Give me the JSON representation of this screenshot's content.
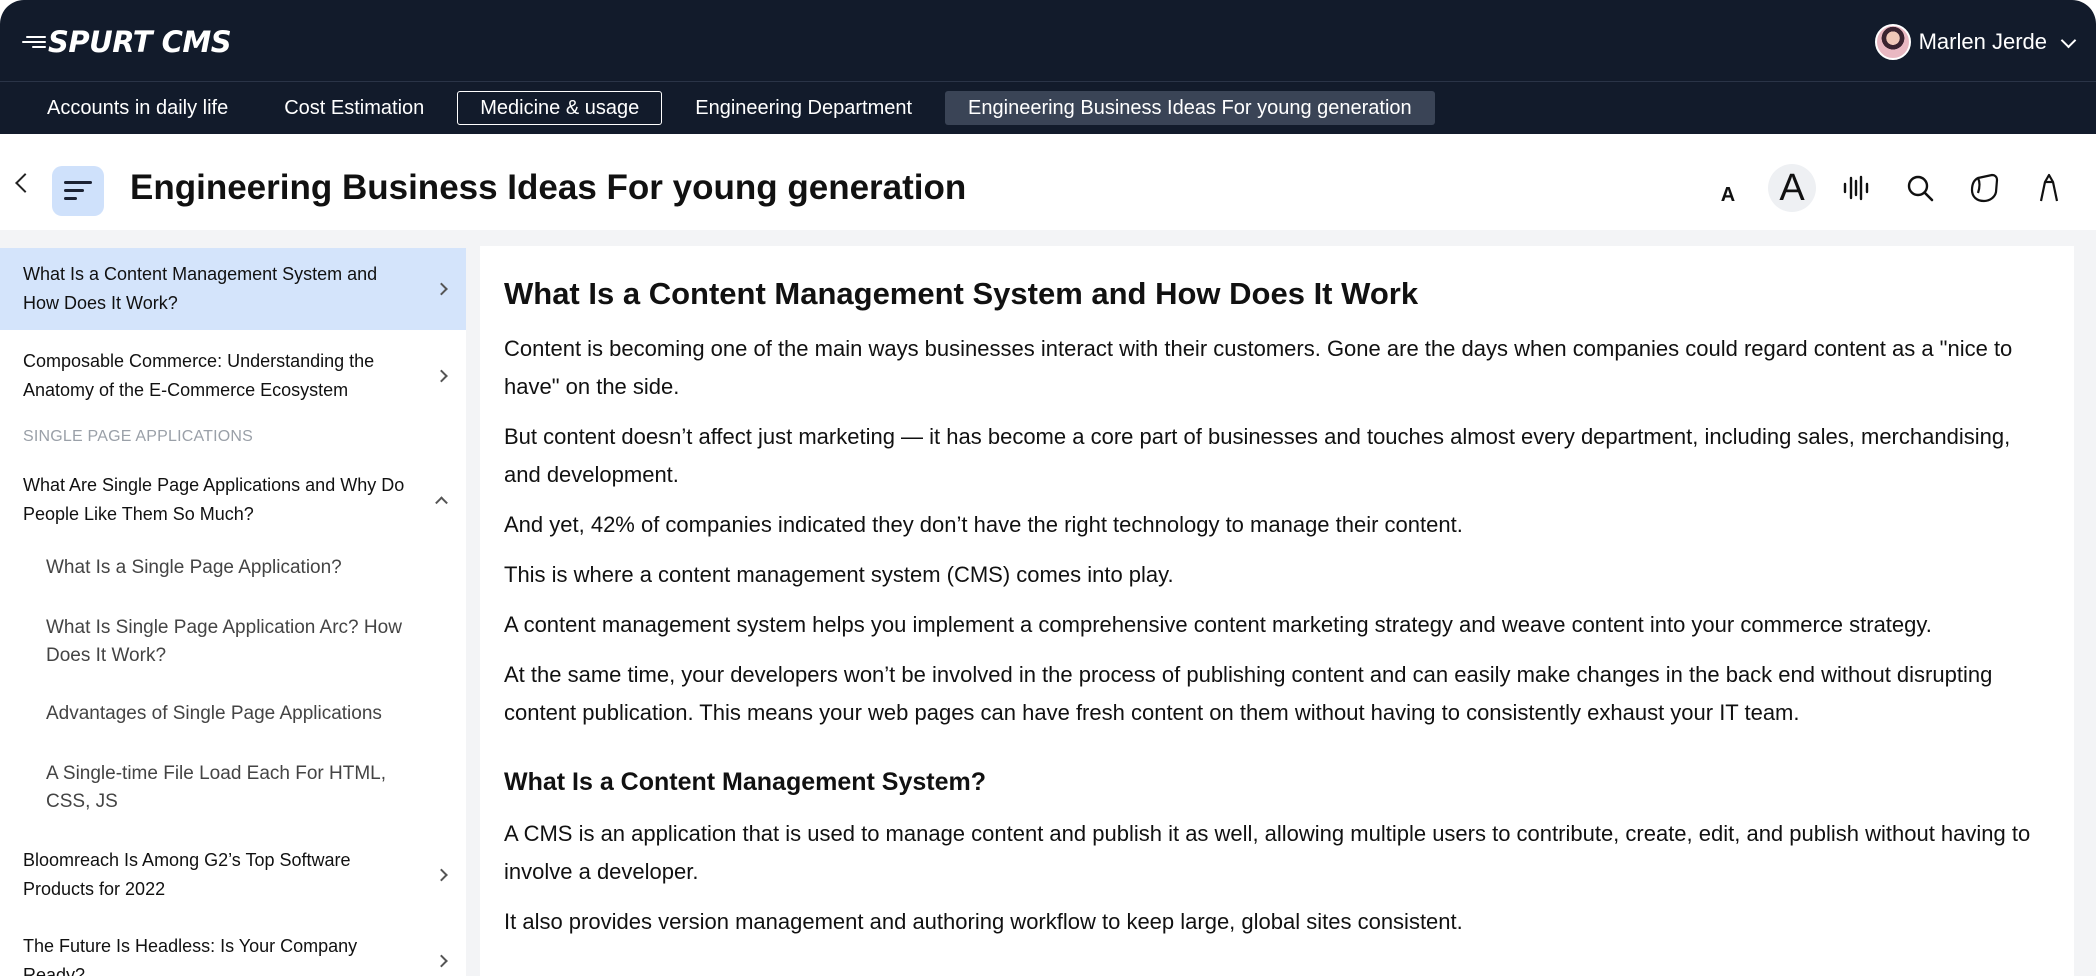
{
  "app": {
    "logo_text": "SPURT CMS"
  },
  "user": {
    "name": "Marlen Jerde"
  },
  "tabs": [
    {
      "label": "Accounts in daily life",
      "state": "normal"
    },
    {
      "label": "Cost Estimation",
      "state": "normal"
    },
    {
      "label": "Medicine & usage",
      "state": "outlined"
    },
    {
      "label": "Engineering Department",
      "state": "normal"
    },
    {
      "label": "Engineering Business Ideas For young generation",
      "state": "selected"
    }
  ],
  "header": {
    "title": "Engineering Business Ideas For young generation",
    "font_small_label": "A",
    "font_large_label": "A",
    "tools": [
      "font-decrease-icon",
      "font-increase-icon",
      "audio-icon",
      "search-icon",
      "bookmark-icon",
      "pen-icon"
    ]
  },
  "sidebar": {
    "items": [
      {
        "label": "What Is a Content Management System and How Does It Work?",
        "active": true
      },
      {
        "label": "Composable Commerce: Understanding the Anatomy of the E-Commerce Ecosystem",
        "active": false
      }
    ],
    "section_label": "SINGLE PAGE APPLICATIONS",
    "expanded_item": {
      "label": "What Are Single Page Applications and Why Do People Like Them So Much?"
    },
    "sub_items": [
      "What Is a Single Page Application?",
      "What Is Single Page Application Arc? How Does It Work?",
      "Advantages of Single Page Applications",
      "A Single-time File Load Each For HTML, CSS, JS"
    ],
    "more_items": [
      {
        "label": "Bloomreach Is Among G2’s Top Software Products for 2022"
      },
      {
        "label": "The Future Is Headless: Is Your Company Ready?"
      }
    ]
  },
  "article": {
    "heading": "What Is a Content Management System and How Does It Work",
    "paragraphs": [
      "Content is becoming one of the main ways businesses interact with their customers. Gone are the days when companies could regard content as a \"nice to have\" on the side.",
      "But content doesn’t affect just marketing — it has become a core part of businesses and touches almost every department, including sales, merchandising, and development.",
      "And yet, 42% of companies indicated they don’t have the right technology to manage their content.",
      "This is where a content management system (CMS) comes into play.",
      "A content management system helps you implement a comprehensive content marketing strategy and weave content into your commerce strategy.",
      "At the same time, your developers won’t be involved in the process of publishing content and can easily make changes in the back end without disrupting content publication. This means your web pages can have fresh content on them without having to consistently exhaust your IT team."
    ],
    "subheading": "What Is a Content Management System?",
    "paragraphs2": [
      "A CMS is an application that is used to manage content and publish it as well, allowing multiple users to contribute, create, edit, and publish without having to involve a developer.",
      "It also provides version management and authoring workflow to keep large, global sites consistent."
    ]
  }
}
